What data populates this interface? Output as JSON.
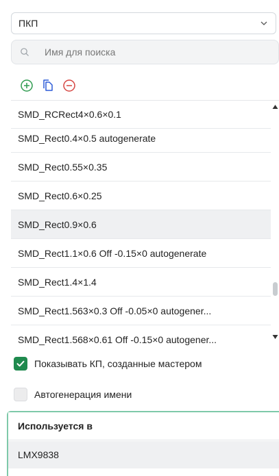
{
  "library_select": {
    "value": "ПКП",
    "icon": "chevron-down-icon"
  },
  "search": {
    "placeholder": "Имя для поиска",
    "value": "",
    "icon": "search-icon"
  },
  "toolbar": {
    "add": {
      "icon": "add-circle-icon",
      "color": "#2e9b4f"
    },
    "copy": {
      "icon": "copy-icon",
      "color": "#2d5bd7"
    },
    "remove": {
      "icon": "remove-circle-icon",
      "color": "#d64541"
    }
  },
  "pads": {
    "items": [
      {
        "label": "SMD_RCRect4×0.6×0.1"
      },
      {
        "label": "SMD_Rect0.4×0.5 autogenerate"
      },
      {
        "label": "SMD_Rect0.55×0.35"
      },
      {
        "label": "SMD_Rect0.6×0.25"
      },
      {
        "label": "SMD_Rect0.9×0.6",
        "selected": true
      },
      {
        "label": "SMD_Rect1.1×0.6 Off -0.15×0 autogenerate"
      },
      {
        "label": "SMD_Rect1.4×1.4"
      },
      {
        "label": "SMD_Rect1.563×0.3 Off -0.05×0 autogener..."
      },
      {
        "label": "SMD_Rect1.568×0.61 Off -0.15×0 autogener..."
      }
    ]
  },
  "options": {
    "show_wizard_pads": {
      "label": "Показывать КП, созданные мастером",
      "checked": true
    },
    "auto_name": {
      "label": "Автогенерация имени",
      "checked": false
    }
  },
  "used_in": {
    "title": "Используется в",
    "items": [
      "LMX9838"
    ]
  },
  "colors": {
    "accent": "#1f8a4e",
    "panel_border": "#7ec9a9",
    "selected_row": "#eff0f2"
  }
}
